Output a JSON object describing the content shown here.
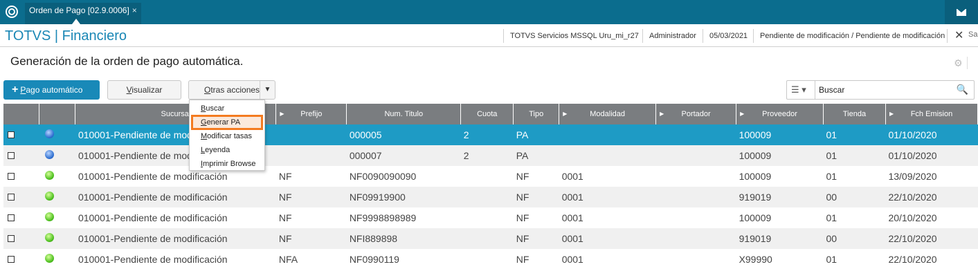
{
  "tab": {
    "label": "Orden de Pago [02.9.0006]",
    "close": "×"
  },
  "app": {
    "title": "TOTVS | Financiero"
  },
  "status": {
    "server": "TOTVS Servicios MSSQL Uru_mi_r27",
    "user": "Administrador",
    "date": "05/03/2021",
    "module": "Pendiente de modificación / Pendiente de modificación",
    "close": "✕",
    "cut": "Sa"
  },
  "page": {
    "title": "Generación de la orden de pago automática."
  },
  "toolbar": {
    "primary_label": "Pago automático",
    "primary_label_first": "P",
    "primary_label_rest": "ago automático",
    "visualizar_first": "V",
    "visualizar_rest": "isualizar",
    "otras_first": "O",
    "otras_rest": "tras acciones"
  },
  "search": {
    "placeholder": "Buscar"
  },
  "menu": {
    "items": [
      {
        "first": "B",
        "rest": "uscar"
      },
      {
        "first": "G",
        "rest": "enerar PA"
      },
      {
        "first": "M",
        "rest": "odificar tasas"
      },
      {
        "first": "L",
        "rest": "eyenda"
      },
      {
        "first": "I",
        "rest": "mprimir Browse"
      }
    ]
  },
  "grid": {
    "columns": [
      "",
      "",
      "Sucursal",
      "Prefijo",
      "Num. Titulo",
      "Cuota",
      "Tipo",
      "Modalidad",
      "Portador",
      "Proveedor",
      "Tienda",
      "Fch Emision"
    ],
    "rows": [
      {
        "status": "blue",
        "sucursal": "010001-Pendiente de modificación",
        "prefijo": "",
        "num": "000005",
        "cuota": "2",
        "tipo": "PA",
        "modalidad": "",
        "portador": "",
        "proveedor": "100009",
        "tienda": "01",
        "fecha": "01/10/2020"
      },
      {
        "status": "blue",
        "sucursal": "010001-Pendiente de modificación",
        "prefijo": "",
        "num": "000007",
        "cuota": "2",
        "tipo": "PA",
        "modalidad": "",
        "portador": "",
        "proveedor": "100009",
        "tienda": "01",
        "fecha": "01/10/2020"
      },
      {
        "status": "green",
        "sucursal": "010001-Pendiente de modificación",
        "prefijo": "NF",
        "num": "NF0090090090",
        "cuota": "",
        "tipo": "NF",
        "modalidad": "0001",
        "portador": "",
        "proveedor": "100009",
        "tienda": "01",
        "fecha": "13/09/2020"
      },
      {
        "status": "green",
        "sucursal": "010001-Pendiente de modificación",
        "prefijo": "NF",
        "num": "NF09919900",
        "cuota": "",
        "tipo": "NF",
        "modalidad": "0001",
        "portador": "",
        "proveedor": "919019",
        "tienda": "00",
        "fecha": "22/10/2020"
      },
      {
        "status": "green",
        "sucursal": "010001-Pendiente de modificación",
        "prefijo": "NF",
        "num": "NF9998898989",
        "cuota": "",
        "tipo": "NF",
        "modalidad": "0001",
        "portador": "",
        "proveedor": "100009",
        "tienda": "01",
        "fecha": "20/10/2020"
      },
      {
        "status": "green",
        "sucursal": "010001-Pendiente de modificación",
        "prefijo": "NF",
        "num": "NFI889898",
        "cuota": "",
        "tipo": "NF",
        "modalidad": "0001",
        "portador": "",
        "proveedor": "919019",
        "tienda": "00",
        "fecha": "22/10/2020"
      },
      {
        "status": "green",
        "sucursal": "010001-Pendiente de modificación",
        "prefijo": "NFA",
        "num": "NF0990119",
        "cuota": "",
        "tipo": "NF",
        "modalidad": "0001",
        "portador": "",
        "proveedor": "X99990",
        "tienda": "01",
        "fecha": "22/10/2020"
      }
    ]
  },
  "colors": {
    "topbar": "#0b6d8e",
    "accent": "#1989b8",
    "selected_row": "#1e9bc5",
    "header": "#7a7d80",
    "highlight": "#f47b20"
  }
}
